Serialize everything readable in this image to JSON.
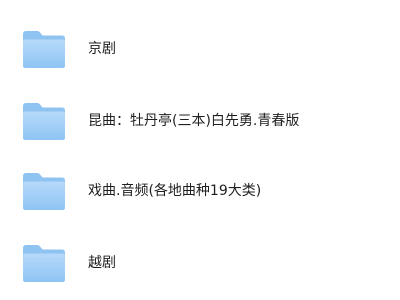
{
  "folders": [
    {
      "name": "京剧",
      "icon": "folder-icon"
    },
    {
      "name": "昆曲：牡丹亭(三本)白先勇.青春版",
      "icon": "folder-icon"
    },
    {
      "name": "戏曲.音频(各地曲种19大类)",
      "icon": "folder-icon"
    },
    {
      "name": "越剧",
      "icon": "folder-icon"
    }
  ],
  "colors": {
    "folder_back": "#8fc3f2",
    "folder_front_top": "#b6dafb",
    "folder_front_bottom": "#8ec4f3",
    "label_text": "#1f1f1f"
  }
}
